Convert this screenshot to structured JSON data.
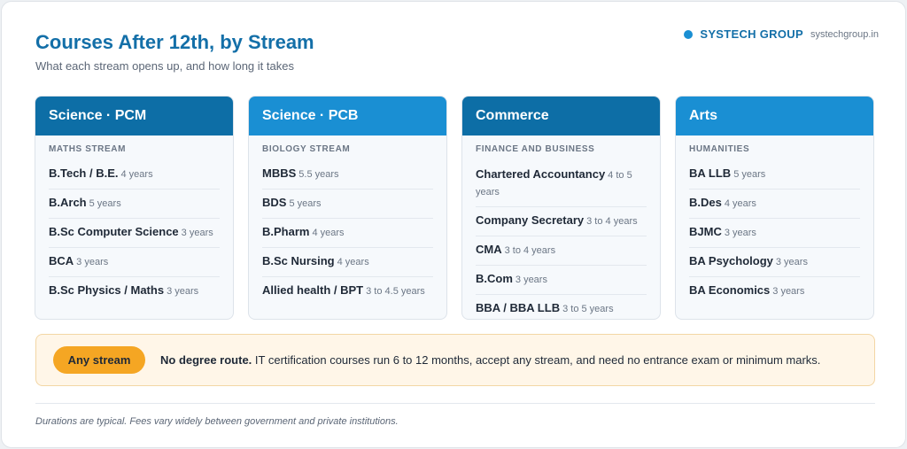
{
  "header": {
    "title": "Courses After 12th, by Stream",
    "subtitle": "What each stream opens up, and how long it takes"
  },
  "brand": {
    "name": "SYSTECH GROUP",
    "url": "systechgroup.in",
    "accent": "#1a8fd3"
  },
  "colors": {
    "header_dark": "#0d6ea6",
    "header_light": "#1a8fd3",
    "pill": "#f5a623",
    "banner_bg": "#fff6e8"
  },
  "streams": [
    {
      "title": "Science · PCM",
      "subtitle": "MATHS STREAM",
      "courses": [
        {
          "name": "B.Tech / B.E.",
          "duration": "4 years"
        },
        {
          "name": "B.Arch",
          "duration": "5 years"
        },
        {
          "name": "B.Sc Computer Science",
          "duration": "3 years"
        },
        {
          "name": "BCA",
          "duration": "3 years"
        },
        {
          "name": "B.Sc Physics / Maths",
          "duration": "3 years"
        }
      ]
    },
    {
      "title": "Science · PCB",
      "subtitle": "BIOLOGY STREAM",
      "courses": [
        {
          "name": "MBBS",
          "duration": "5.5 years"
        },
        {
          "name": "BDS",
          "duration": "5 years"
        },
        {
          "name": "B.Pharm",
          "duration": "4 years"
        },
        {
          "name": "B.Sc Nursing",
          "duration": "4 years"
        },
        {
          "name": "Allied health / BPT",
          "duration": "3 to 4.5 years"
        }
      ]
    },
    {
      "title": "Commerce",
      "subtitle": "FINANCE AND BUSINESS",
      "courses": [
        {
          "name": "Chartered Accountancy",
          "duration": "4 to 5 years"
        },
        {
          "name": "Company Secretary",
          "duration": "3 to 4 years"
        },
        {
          "name": "CMA",
          "duration": "3 to 4 years"
        },
        {
          "name": "B.Com",
          "duration": "3 years"
        },
        {
          "name": "BBA / BBA LLB",
          "duration": "3 to 5 years"
        }
      ]
    },
    {
      "title": "Arts",
      "subtitle": "HUMANITIES",
      "courses": [
        {
          "name": "BA LLB",
          "duration": "5 years"
        },
        {
          "name": "B.Des",
          "duration": "4 years"
        },
        {
          "name": "BJMC",
          "duration": "3 years"
        },
        {
          "name": "BA Psychology",
          "duration": "3 years"
        },
        {
          "name": "BA Economics",
          "duration": "3 years"
        }
      ]
    }
  ],
  "banner": {
    "pill": "Any stream",
    "lead": "No degree route.",
    "text": " IT certification courses run 6 to 12 months, accept any stream, and need no entrance exam or minimum marks."
  },
  "footnote": "Durations are typical. Fees vary widely between government and private institutions."
}
